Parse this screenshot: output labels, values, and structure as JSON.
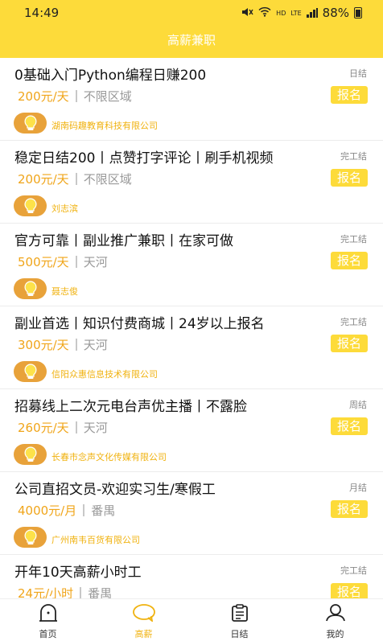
{
  "status_bar": {
    "time": "14:49",
    "hd_label": "HD",
    "lte_label": "LTE",
    "battery_text": "88%"
  },
  "header": {
    "title": "高薪兼职"
  },
  "jobs": [
    {
      "title": "0基础入门Python编程日赚200",
      "settle": "日结",
      "salary": "200元/天",
      "area": "不限区域",
      "apply_label": "报名",
      "company": "湖南码趣教育科技有限公司"
    },
    {
      "title": "稳定日结200丨点赞打字评论丨刷手机视频",
      "settle": "完工结",
      "salary": "200元/天",
      "area": "不限区域",
      "apply_label": "报名",
      "company": "刘志滨"
    },
    {
      "title": "官方可靠丨副业推广兼职丨在家可做",
      "settle": "完工结",
      "salary": "500元/天",
      "area": "天河",
      "apply_label": "报名",
      "company": "聂志俊"
    },
    {
      "title": "副业首选丨知识付费商城丨24岁以上报名",
      "settle": "完工结",
      "salary": "300元/天",
      "area": "天河",
      "apply_label": "报名",
      "company": "信阳众惠信息技术有限公司"
    },
    {
      "title": "招募线上二次元电台声优主播丨不露脸",
      "settle": "周结",
      "salary": "260元/天",
      "area": "天河",
      "apply_label": "报名",
      "company": "长春市念声文化传媒有限公司"
    },
    {
      "title": "公司直招文员-欢迎实习生/寒假工",
      "settle": "月结",
      "salary": "4000元/月",
      "area": "番禺",
      "apply_label": "报名",
      "company": "广州南韦百货有限公司"
    },
    {
      "title": "开年10天高薪小时工",
      "settle": "完工结",
      "salary": "24元/小时",
      "area": "番禺",
      "apply_label": "报名",
      "company": ""
    }
  ],
  "tabs": [
    {
      "label": "首页",
      "icon": "home-icon"
    },
    {
      "label": "高薪",
      "icon": "chat-bubble-icon",
      "active": true
    },
    {
      "label": "日结",
      "icon": "clipboard-icon"
    },
    {
      "label": "我的",
      "icon": "person-icon"
    }
  ],
  "colors": {
    "accent": "#fddb3a",
    "salary": "#f0a51a",
    "company": "#f0b20f"
  }
}
